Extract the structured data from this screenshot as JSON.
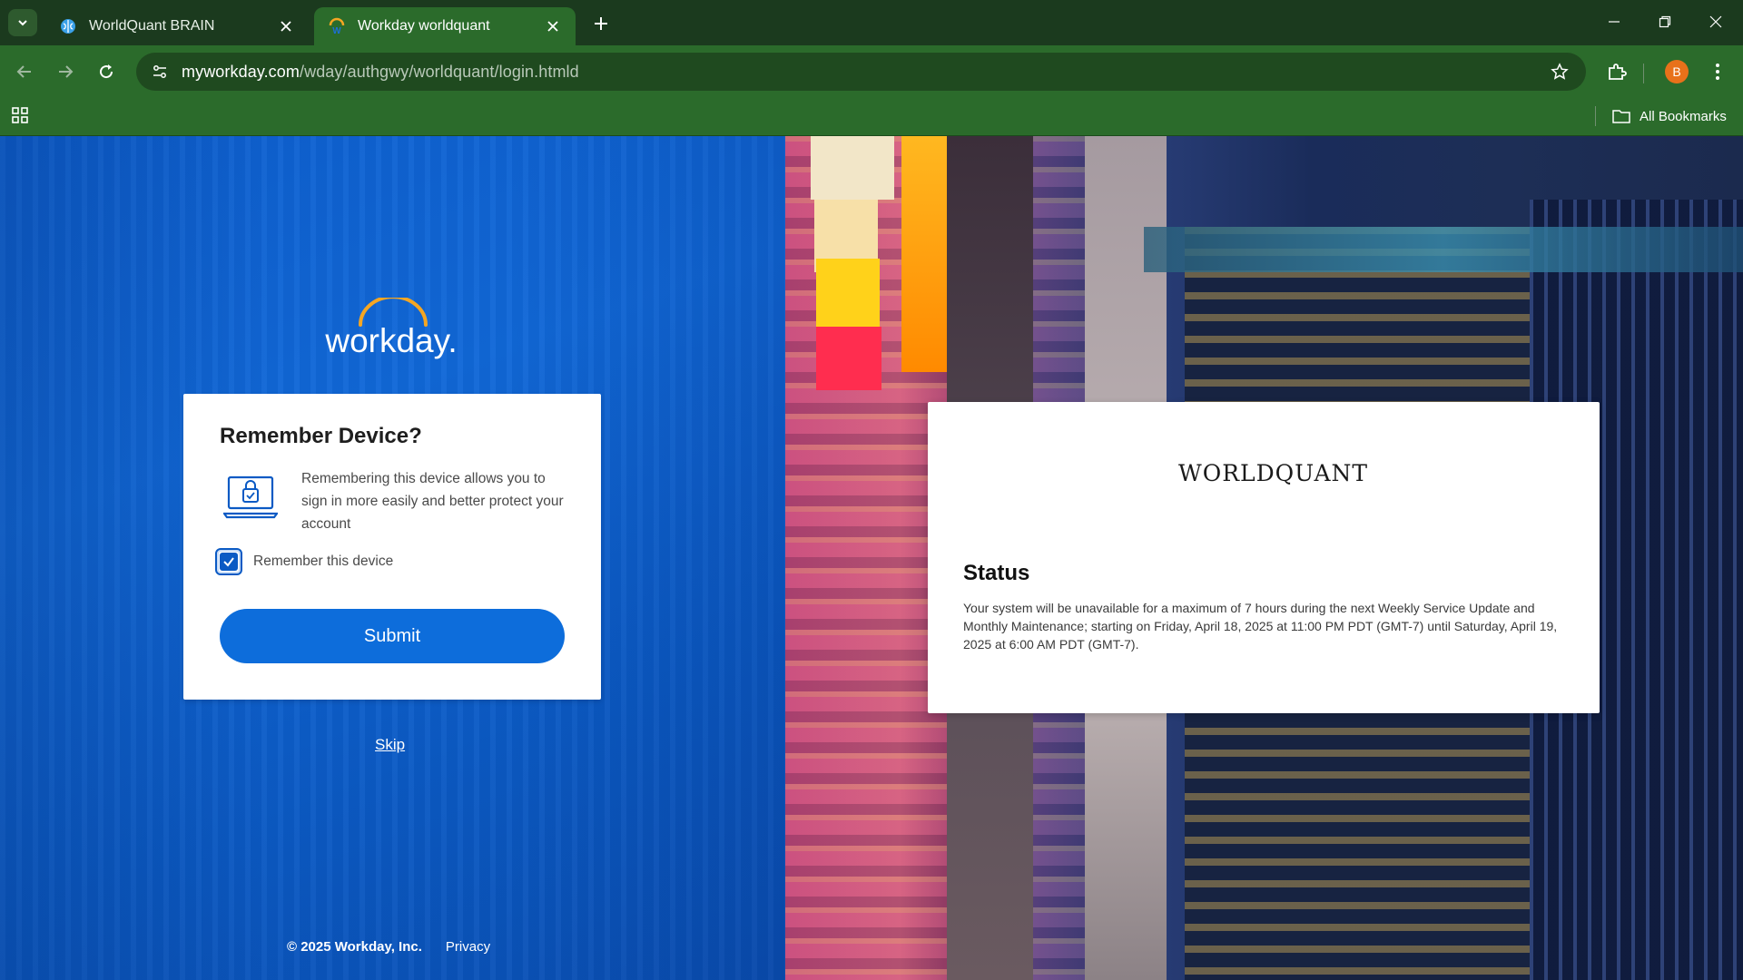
{
  "browser": {
    "tabs": [
      {
        "title": "WorldQuant BRAIN",
        "favicon": "brain-icon",
        "active": false
      },
      {
        "title": "Workday worldquant",
        "favicon": "workday-icon",
        "active": true
      }
    ],
    "url_domain": "myworkday.com",
    "url_path": "/wday/authgwy/worldquant/login.htmld",
    "profile_initial": "B",
    "bookmarks_label": "All Bookmarks",
    "colors": {
      "frame": "#1b3a1e",
      "toolbar": "#2b6b2b",
      "avatar": "#e8711a"
    }
  },
  "login": {
    "logo_text": "workday.",
    "card": {
      "title": "Remember Device?",
      "description": "Remembering this device allows you to sign in more easily and better protect your account",
      "checkbox_label": "Remember this device",
      "checkbox_checked": true,
      "submit_label": "Submit"
    },
    "skip_label": "Skip",
    "footer": {
      "copyright": "© 2025 Workday, Inc.",
      "privacy": "Privacy"
    },
    "accent_color": "#0d6ddb"
  },
  "status": {
    "logo_text": "WORLDQUANT",
    "title": "Status",
    "message": "Your system will be unavailable for a maximum of 7 hours during the next Weekly Service Update and Monthly Maintenance; starting on Friday, April 18, 2025 at 11:00 PM PDT (GMT-7) until Saturday, April 19, 2025 at 6:00 AM PDT (GMT-7)."
  }
}
